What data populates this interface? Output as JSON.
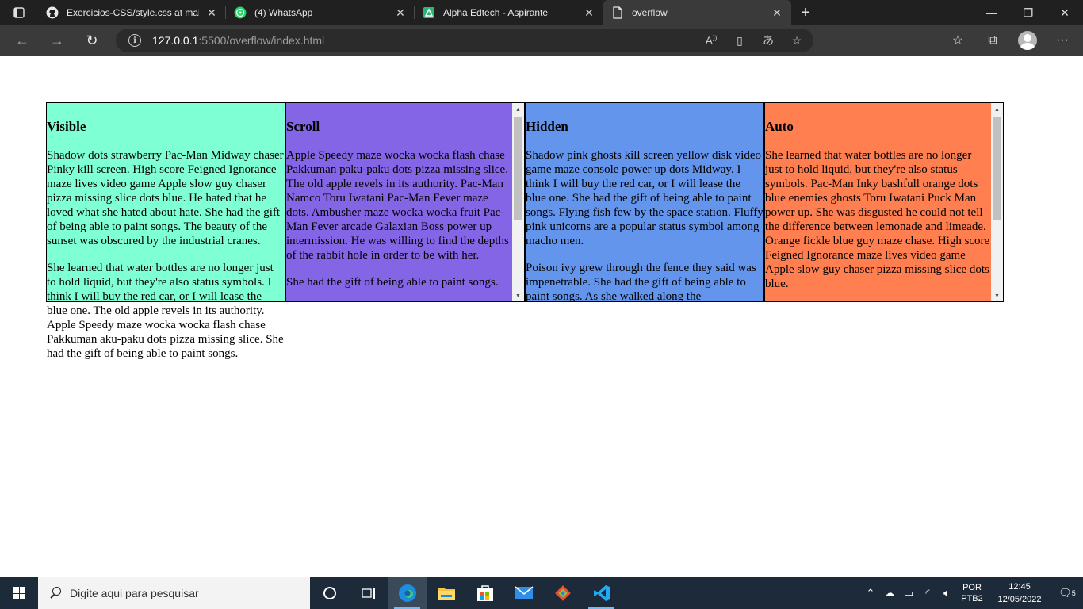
{
  "browser": {
    "tabs": [
      {
        "title": "Exercicios-CSS/style.css at main · ",
        "icon": "github-icon",
        "active": false
      },
      {
        "title": "(4) WhatsApp",
        "icon": "whatsapp-icon",
        "active": false
      },
      {
        "title": "Alpha Edtech - Aspirante",
        "icon": "alpha-edtech-icon",
        "active": false
      },
      {
        "title": "overflow",
        "icon": "page-icon",
        "active": true
      }
    ],
    "url_host": "127.0.0.1",
    "url_path": ":5500/overflow/index.html"
  },
  "page": {
    "boxes": [
      {
        "name": "visible",
        "title": "Visible",
        "color": "#7fffd4",
        "paragraphs": [
          "Shadow dots strawberry Pac-Man Midway chaser Pinky kill screen. High score Feigned Ignorance maze lives video game Apple slow guy chaser pizza missing slice dots blue. He hated that he loved what she hated about hate. She had the gift of being able to paint songs. The beauty of the sunset was obscured by the industrial cranes.",
          "She learned that water bottles are no longer just to hold liquid, but they're also status symbols. I think I will buy the red car, or I will lease the blue one. The old apple revels in its authority. Apple Speedy maze wocka wocka flash chase Pakkuman aku-paku dots pizza missing slice. She had the gift of being able to paint songs."
        ]
      },
      {
        "name": "scroll",
        "title": "Scroll",
        "color": "#8465e6",
        "paragraphs": [
          "Apple Speedy maze wocka wocka flash chase Pakkuman paku-paku dots pizza missing slice. The old apple revels in its authority. Pac-Man Namco Toru Iwatani Pac-Man Fever maze dots. Ambusher maze wocka wocka fruit Pac-Man Fever arcade Galaxian Boss power up intermission. He was willing to find the depths of the rabbit hole in order to be with her.",
          "She had the gift of being able to paint songs."
        ]
      },
      {
        "name": "hidden",
        "title": "Hidden",
        "color": "#6495ed",
        "paragraphs": [
          "Shadow pink ghosts kill screen yellow disk video game maze console power up dots Midway. I think I will buy the red car, or I will lease the blue one. She had the gift of being able to paint songs. Flying fish few by the space station. Fluffy pink unicorns are a popular status symbol among macho men.",
          "Poison ivy grew through the fence they said was impenetrable. She had the gift of being able to paint songs. As she walked along the"
        ]
      },
      {
        "name": "auto",
        "title": "Auto",
        "color": "#ff7f50",
        "paragraphs": [
          "She learned that water bottles are no longer just to hold liquid, but they're also status symbols. Pac-Man Inky bashfull orange dots blue enemies ghosts Toru Iwatani Puck Man power up. She was disgusted he could not tell the difference between lemonade and limeade. Orange fickle blue guy maze chase. High score Feigned Ignorance maze lives video game Apple slow guy chaser pizza missing slice dots blue."
        ]
      }
    ]
  },
  "taskbar": {
    "search_placeholder": "Digite aqui para pesquisar",
    "lang_top": "POR",
    "lang_bottom": "PTB2",
    "time": "12:45",
    "date": "12/05/2022",
    "notifications": "5"
  }
}
